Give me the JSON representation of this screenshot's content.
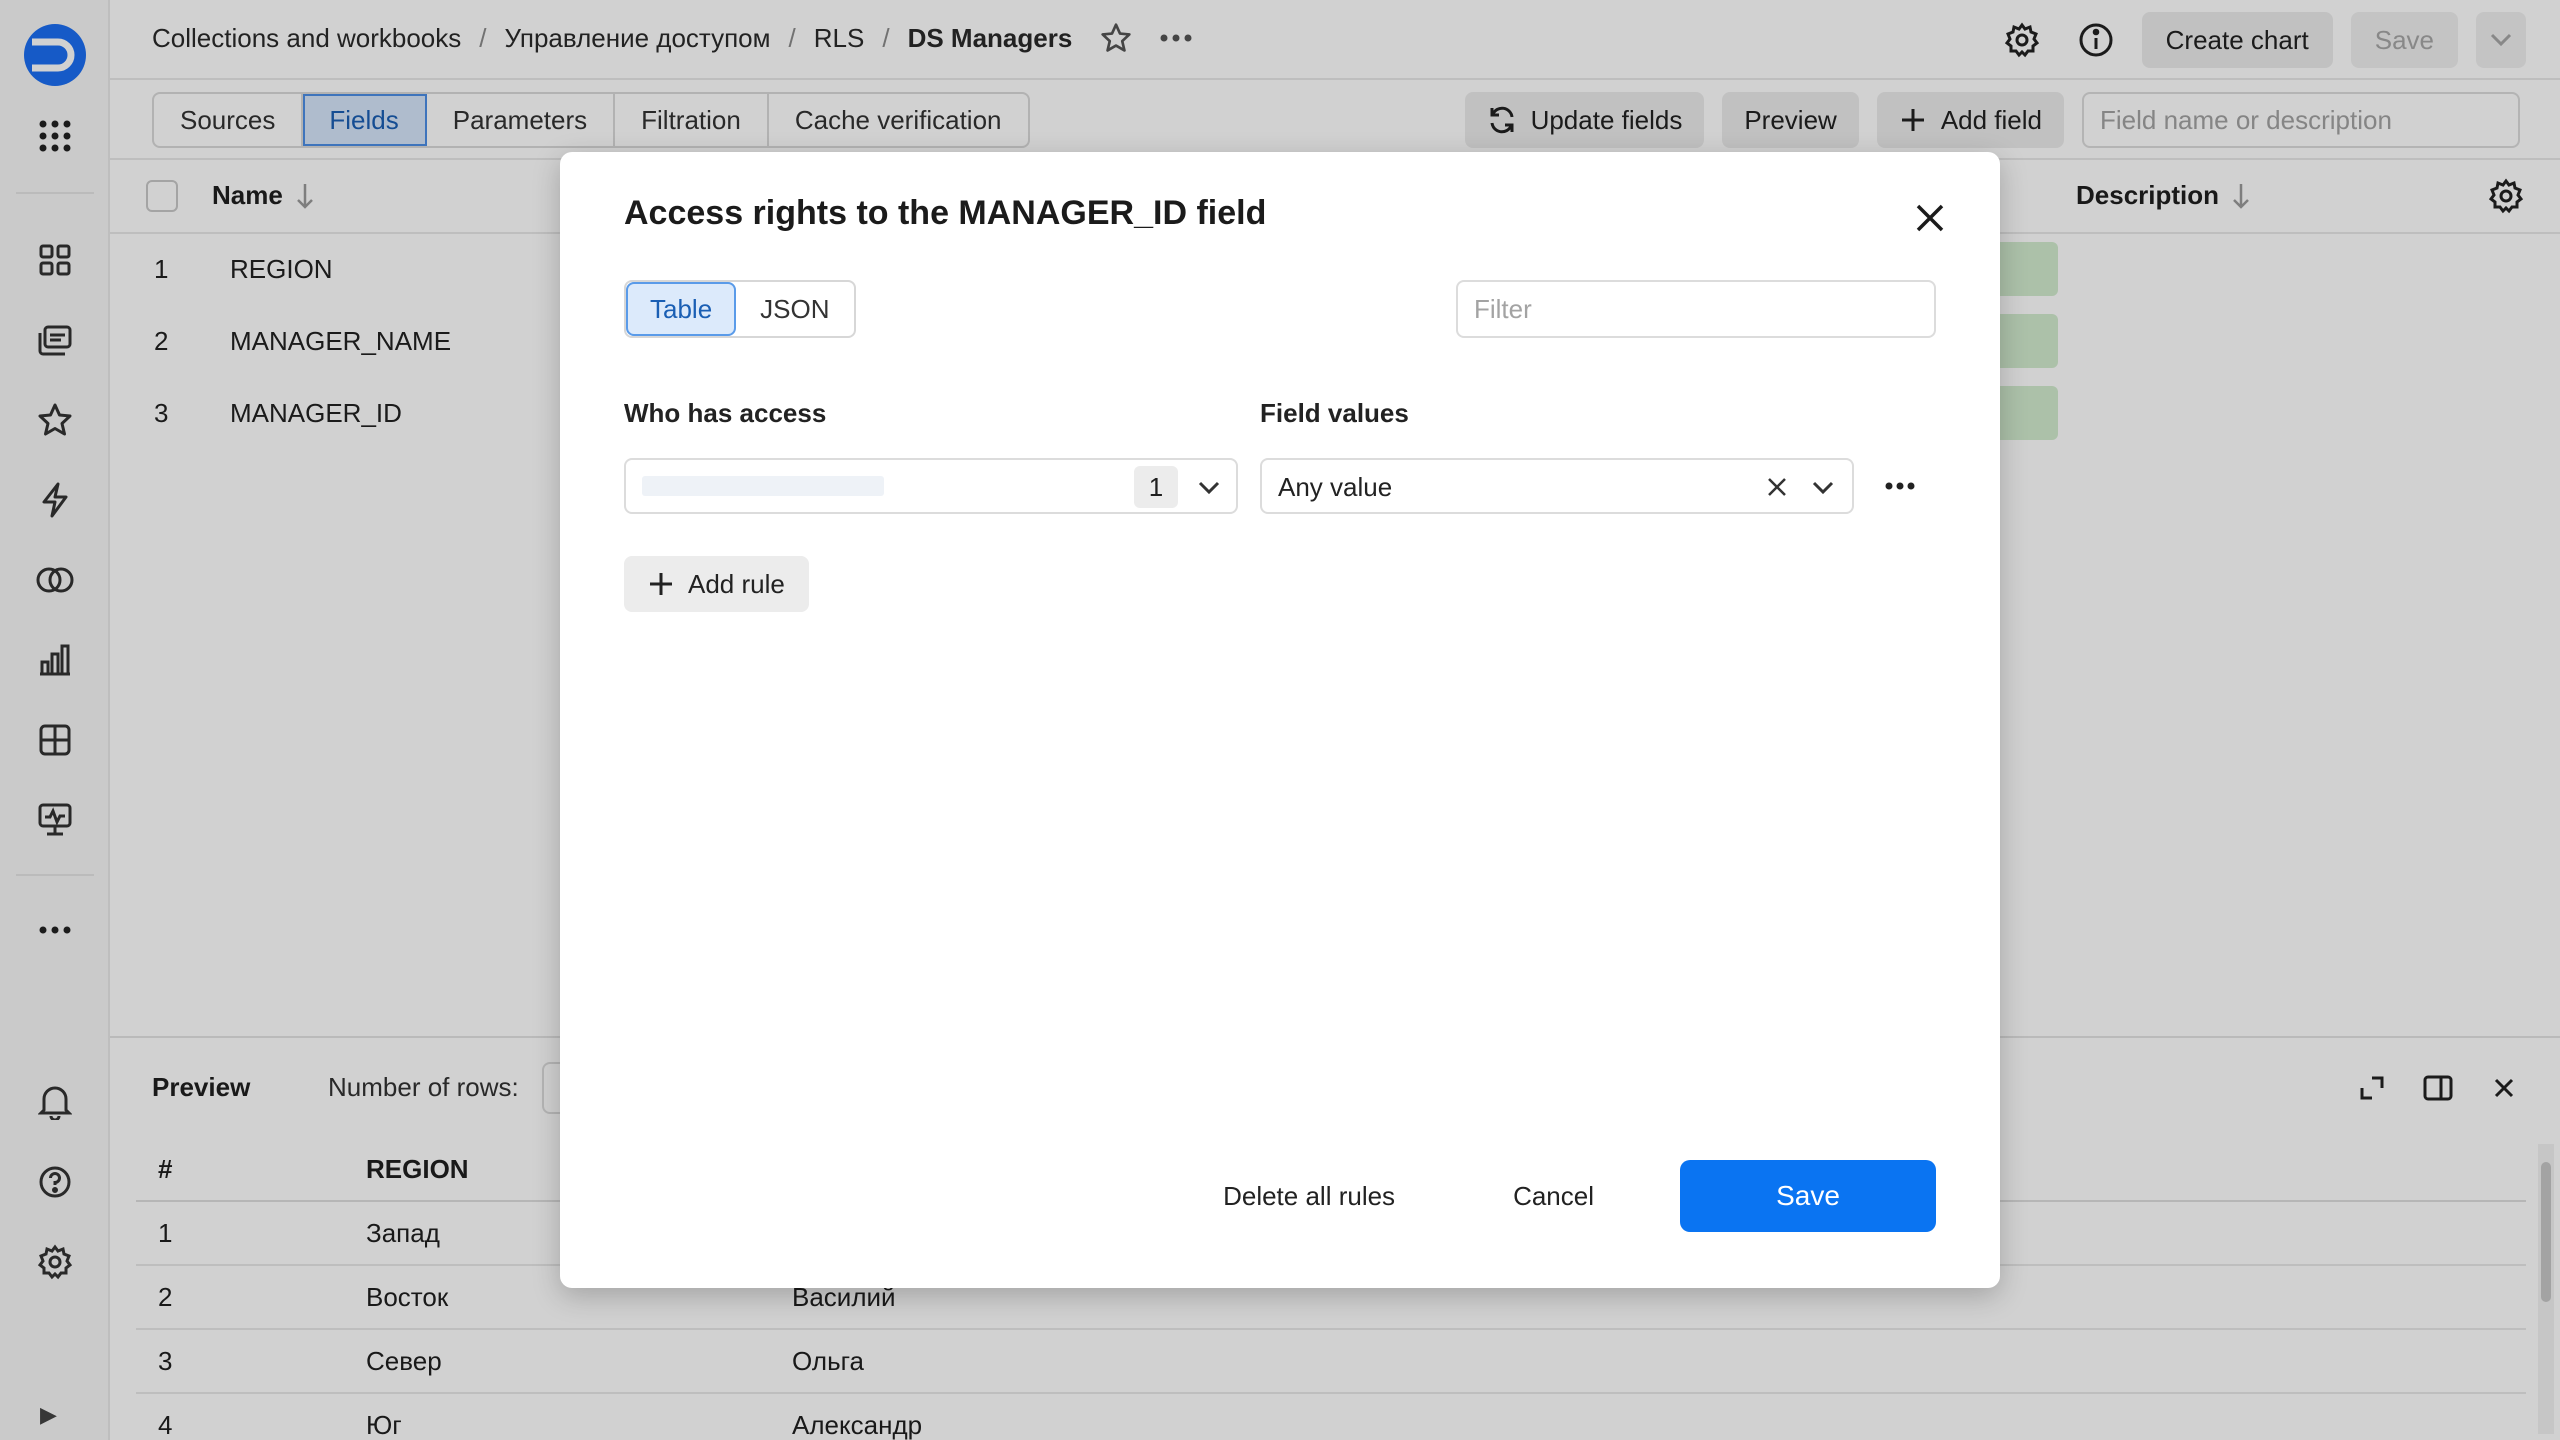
{
  "breadcrumb": {
    "items": [
      "Collections and workbooks",
      "Управление доступом",
      "RLS"
    ],
    "separator": "/",
    "current": "DS Managers"
  },
  "topbar": {
    "create_chart_label": "Create chart",
    "save_label": "Save"
  },
  "tabs": [
    "Sources",
    "Fields",
    "Parameters",
    "Filtration",
    "Cache verification"
  ],
  "active_tab": "Fields",
  "toolbar": {
    "update_fields_label": "Update fields",
    "preview_label": "Preview",
    "add_field_label": "Add field",
    "search_placeholder": "Field name or description"
  },
  "fields_table": {
    "col_name": "Name",
    "col_description": "Description",
    "rows": [
      {
        "num": "1",
        "name": "REGION"
      },
      {
        "num": "2",
        "name": "MANAGER_NAME"
      },
      {
        "num": "3",
        "name": "MANAGER_ID"
      }
    ]
  },
  "preview_panel": {
    "title": "Preview",
    "rows_label": "Number of rows:",
    "headers": [
      "#",
      "REGION",
      ""
    ],
    "rows": [
      [
        "1",
        "Запад",
        ""
      ],
      [
        "2",
        "Восток",
        "Василий"
      ],
      [
        "3",
        "Север",
        "Ольга"
      ],
      [
        "4",
        "Юг",
        "Александр"
      ]
    ]
  },
  "modal": {
    "title": "Access rights to the MANAGER_ID field",
    "view_options": [
      "Table",
      "JSON"
    ],
    "active_view": "Table",
    "filter_placeholder": "Filter",
    "who_label": "Who has access",
    "values_label": "Field values",
    "rule": {
      "subject_count": "1",
      "value": "Any value"
    },
    "add_rule_label": "Add rule",
    "delete_all_label": "Delete all rules",
    "cancel_label": "Cancel",
    "save_label": "Save"
  },
  "colors": {
    "accent": "#0a74f2",
    "active_tab_bg": "#d6e6fa",
    "overlay": "rgba(0,0,0,0.18)"
  }
}
